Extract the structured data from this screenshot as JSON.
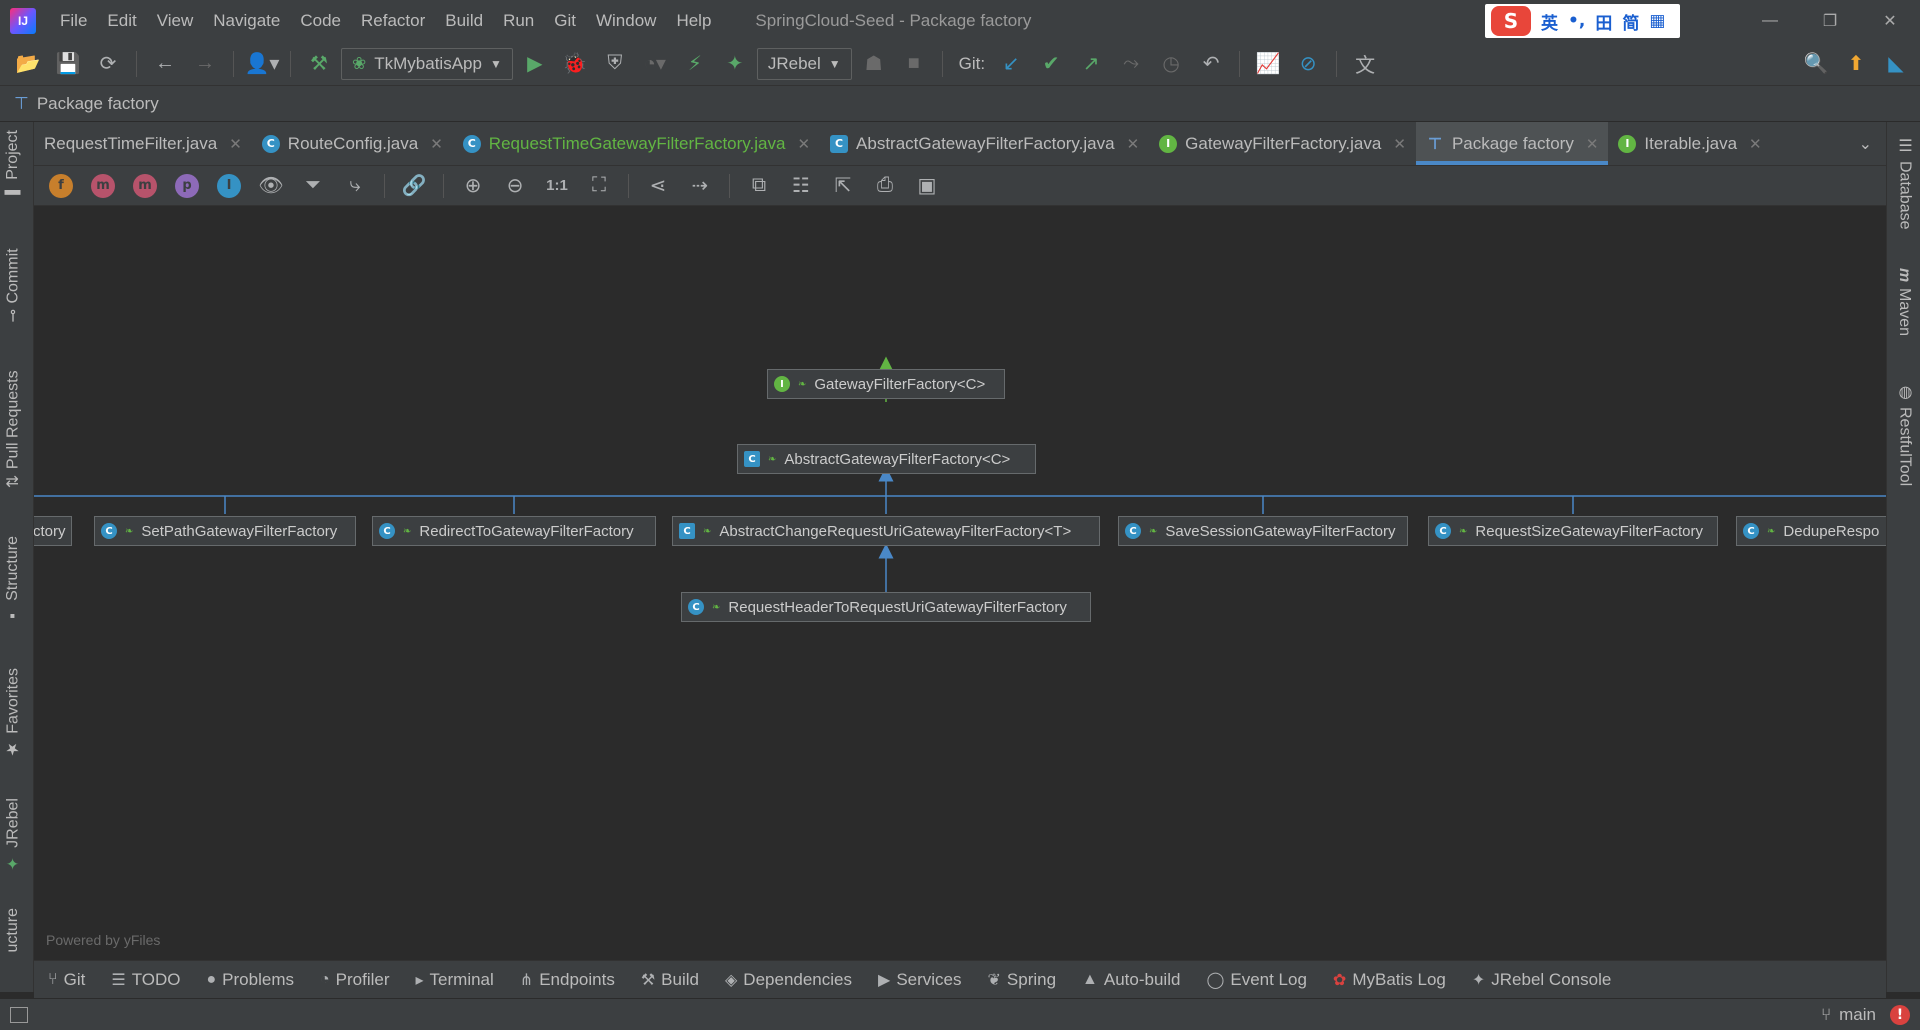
{
  "window": {
    "title": "SpringCloud-Seed - Package factory",
    "logo_text": "IJ",
    "ime": {
      "logo": "S",
      "mode": "英",
      "punct": "•,",
      "grid": "田",
      "simp": "简",
      "apps": "▦"
    }
  },
  "menu": [
    "File",
    "Edit",
    "View",
    "Navigate",
    "Code",
    "Refactor",
    "Build",
    "Run",
    "Git",
    "Window",
    "Help"
  ],
  "toolbar": {
    "run_config": "TkMybatisApp",
    "jrebel": "JRebel",
    "git_label": "Git:"
  },
  "breadcrumb": {
    "label": "Package factory"
  },
  "left_tabs": [
    "Project",
    "Commit",
    "Pull Requests",
    "Structure",
    "Favorites",
    "JRebel",
    "ucture"
  ],
  "right_tabs": [
    "Database",
    "Maven",
    "RestfulTool"
  ],
  "editor_tabs": [
    {
      "label": "RequestTimeFilter.java",
      "icon": "none",
      "modified": false,
      "active": false
    },
    {
      "label": "RouteConfig.java",
      "icon": "class",
      "modified": false,
      "active": false
    },
    {
      "label": "RequestTimeGatewayFilterFactory.java",
      "icon": "class",
      "modified": true,
      "active": false
    },
    {
      "label": "AbstractGatewayFilterFactory.java",
      "icon": "abstract",
      "modified": false,
      "active": false
    },
    {
      "label": "GatewayFilterFactory.java",
      "icon": "interface",
      "modified": false,
      "active": false
    },
    {
      "label": "Package factory",
      "icon": "package",
      "modified": false,
      "active": true
    },
    {
      "label": "Iterable.java",
      "icon": "interface",
      "modified": false,
      "active": false
    }
  ],
  "diagram_toolbar": {
    "fields": "f",
    "methods": "m",
    "constructors": "m",
    "properties": "p",
    "inner": "I",
    "actual_size": "1:1"
  },
  "diagram": {
    "powered_by": "Powered by yFiles",
    "nodes": {
      "gateway_filter_factory": "GatewayFilterFactory<C>",
      "abstract_gateway_filter_factory": "AbstractGatewayFilterFactory<C>",
      "partial_left": "ctory",
      "set_path": "SetPathGatewayFilterFactory",
      "redirect_to": "RedirectToGatewayFilterFactory",
      "abstract_change": "AbstractChangeRequestUriGatewayFilterFactory<T>",
      "save_session": "SaveSessionGatewayFilterFactory",
      "request_size": "RequestSizeGatewayFilterFactory",
      "dedupe_partial": "DedupeRespo",
      "request_header": "RequestHeaderToRequestUriGatewayFilterFactory"
    }
  },
  "bottom_tools": [
    "Git",
    "TODO",
    "Problems",
    "Profiler",
    "Terminal",
    "Endpoints",
    "Build",
    "Dependencies",
    "Services",
    "Spring",
    "Auto-build",
    "Event Log",
    "MyBatis Log",
    "JRebel Console"
  ],
  "status": {
    "branch": "main",
    "error_mark": "!"
  },
  "colors": {
    "accent": "#4a88c7",
    "class_icon": "#3592c4",
    "interface_icon": "#62b543",
    "modified": "#62b543",
    "background": "#2b2b2b",
    "panel": "#3c3f41"
  }
}
